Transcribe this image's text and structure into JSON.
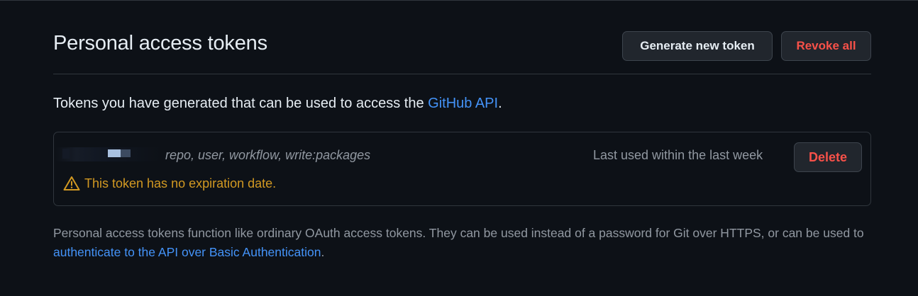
{
  "header": {
    "title": "Personal access tokens",
    "generate_label": "Generate new token",
    "revoke_label": "Revoke all"
  },
  "intro": {
    "text_before": "Tokens you have generated that can be used to access the ",
    "link_text": "GitHub API",
    "text_after": "."
  },
  "token": {
    "scopes": "repo, user, workflow, write:packages",
    "last_used": "Last used within the last week",
    "delete_label": "Delete",
    "warning": "This token has no expiration date.",
    "warning_icon": "alert-icon"
  },
  "footer": {
    "text_before": "Personal access tokens function like ordinary OAuth access tokens. They can be used instead of a password for Git over HTTPS, or can be used to ",
    "link_text": "authenticate to the API over Basic Authentication",
    "text_after": "."
  },
  "colors": {
    "background": "#0d1117",
    "border": "#30363d",
    "link": "#4493f8",
    "danger": "#f85149",
    "warning": "#d29922",
    "muted": "#9198a1"
  }
}
